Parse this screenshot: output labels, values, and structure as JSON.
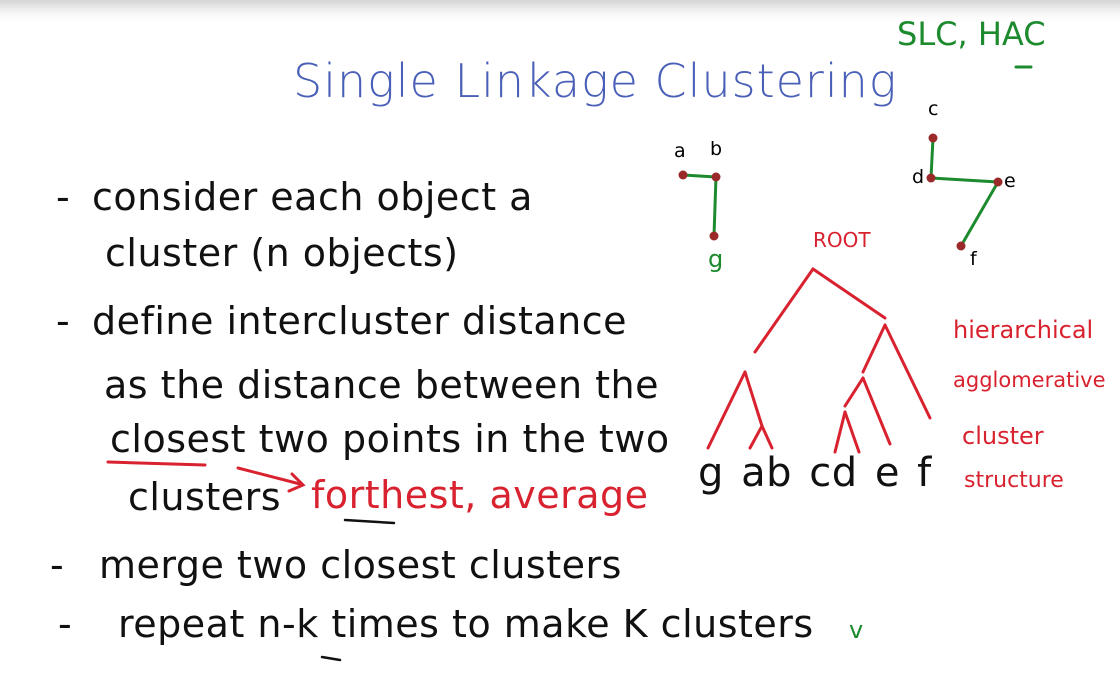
{
  "title": "Single Linkage Clustering",
  "corner_note": "SLC, HAC",
  "bullets": [
    {
      "dash": "-",
      "lines": [
        "consider each object a",
        "cluster (n objects)"
      ]
    },
    {
      "dash": "-",
      "lines": [
        "define intercluster distance",
        "as the distance between the",
        "closest two points in the two",
        "clusters"
      ]
    },
    {
      "dash": "-",
      "lines": [
        "merge two closest clusters"
      ]
    },
    {
      "dash": "-",
      "lines": [
        "repeat n-k times to make K clusters"
      ]
    }
  ],
  "alt_linkages": "forthest, average",
  "checkmark": "v",
  "graph_points": {
    "a": "a",
    "b": "b",
    "g": "g",
    "c": "c",
    "d": "d",
    "e": "e",
    "f": "f"
  },
  "dendrogram": {
    "root_label": "ROOT",
    "leaves": "g ab cd e f"
  },
  "side_note": [
    "hierarchical",
    "agglomerative",
    "cluster",
    "structure"
  ],
  "colors": {
    "title": "#4a5fb8",
    "ink": "#111111",
    "red": "#d9222f",
    "green": "#1d8a2e"
  }
}
